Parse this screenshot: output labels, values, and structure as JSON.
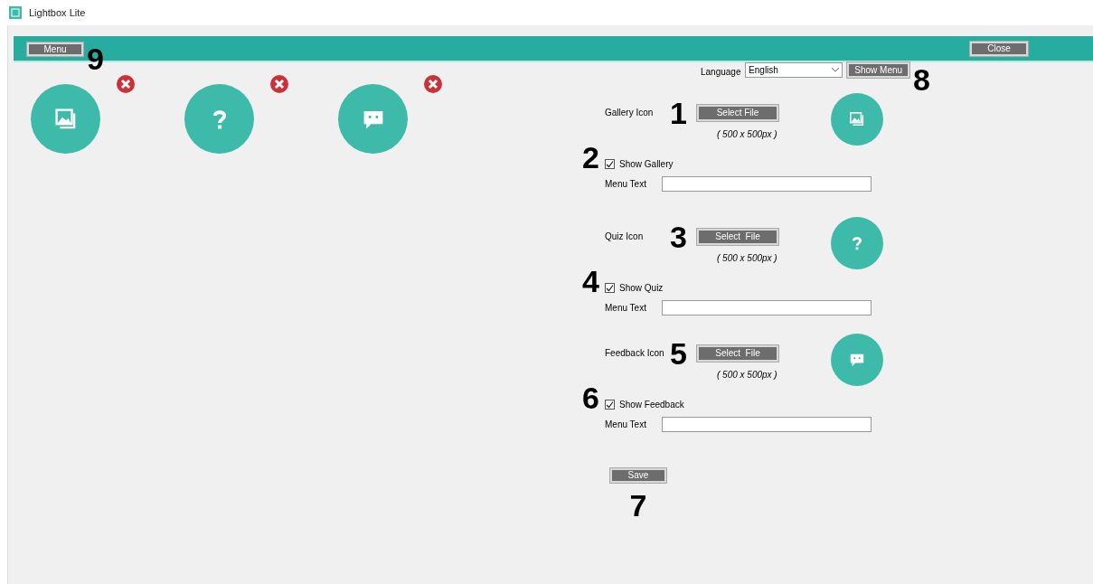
{
  "window": {
    "title": "Lightbox Lite"
  },
  "toolbar": {
    "menu_button": "Menu",
    "menu_annotation": "9",
    "close_button": "Close"
  },
  "tiles": [
    {
      "kind": "gallery"
    },
    {
      "kind": "quiz"
    },
    {
      "kind": "feedback"
    }
  ],
  "language": {
    "label": "Language",
    "value": "English",
    "show_menu_button": "Show Menu",
    "annotation": "8"
  },
  "sections": [
    {
      "kind": "gallery",
      "label": "Gallery Icon",
      "annotation": "1",
      "button": "Select File",
      "hint": "( 500 x 500px )",
      "checkbox_annotation": "2",
      "checkbox_label": "Show Gallery",
      "checked": true,
      "menu_text_label": "Menu Text"
    },
    {
      "kind": "quiz",
      "label": "Quiz Icon",
      "annotation": "3",
      "button": "Select  File",
      "hint": "( 500 x 500px )",
      "checkbox_annotation": "4",
      "checkbox_label": "Show Quiz",
      "checked": true,
      "menu_text_label": "Menu Text"
    },
    {
      "kind": "feedback",
      "label": "Feedback Icon",
      "annotation": "5",
      "button": "Select  File",
      "hint": "( 500 x 500px )",
      "checkbox_annotation": "6",
      "checkbox_label": "Show Feedback",
      "checked": true,
      "menu_text_label": "Menu Text"
    }
  ],
  "save": {
    "button": "Save",
    "annotation": "7"
  }
}
